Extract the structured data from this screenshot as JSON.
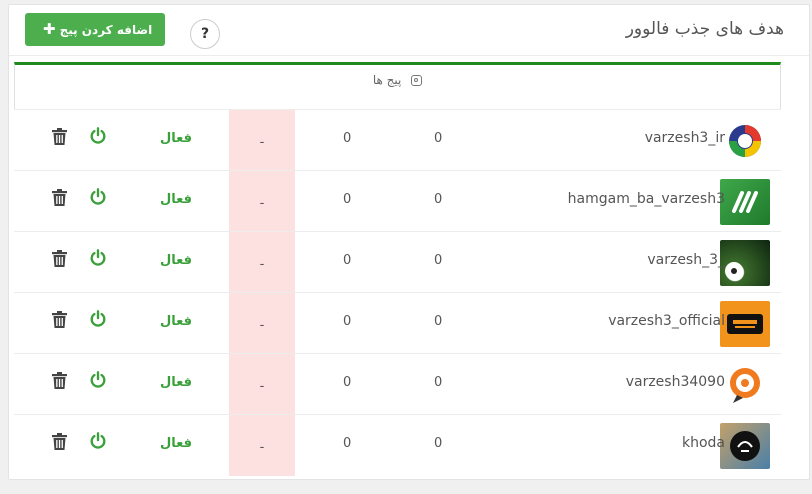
{
  "header": {
    "title": "هدف های جذب فالوور",
    "add_button_label": "اضافه کردن پیج",
    "add_button_icon": "plus-icon",
    "help_label": "?"
  },
  "table": {
    "heading": "پیج ها",
    "heading_icon": "instagram-icon",
    "accent_color": "#1e8a1e",
    "rows": [
      {
        "username": "varzesh3_ir",
        "count_a": "0",
        "count_b": "0",
        "extra": "-",
        "status": "فعال"
      },
      {
        "username": "hamgam_ba_varzesh3",
        "count_a": "0",
        "count_b": "0",
        "extra": "-",
        "status": "فعال"
      },
      {
        "username": "varzesh_3_",
        "count_a": "0",
        "count_b": "0",
        "extra": "-",
        "status": "فعال"
      },
      {
        "username": "varzesh3_official",
        "count_a": "0",
        "count_b": "0",
        "extra": "-",
        "status": "فعال"
      },
      {
        "username": "varzesh34090",
        "count_a": "0",
        "count_b": "0",
        "extra": "-",
        "status": "فعال"
      },
      {
        "username": "khoda",
        "count_a": "0",
        "count_b": "0",
        "extra": "-",
        "status": "فعال"
      }
    ]
  },
  "colors": {
    "primary_button": "#4cae4c",
    "status_active": "#3aa03a",
    "highlight_cell": "#fde0e0"
  }
}
